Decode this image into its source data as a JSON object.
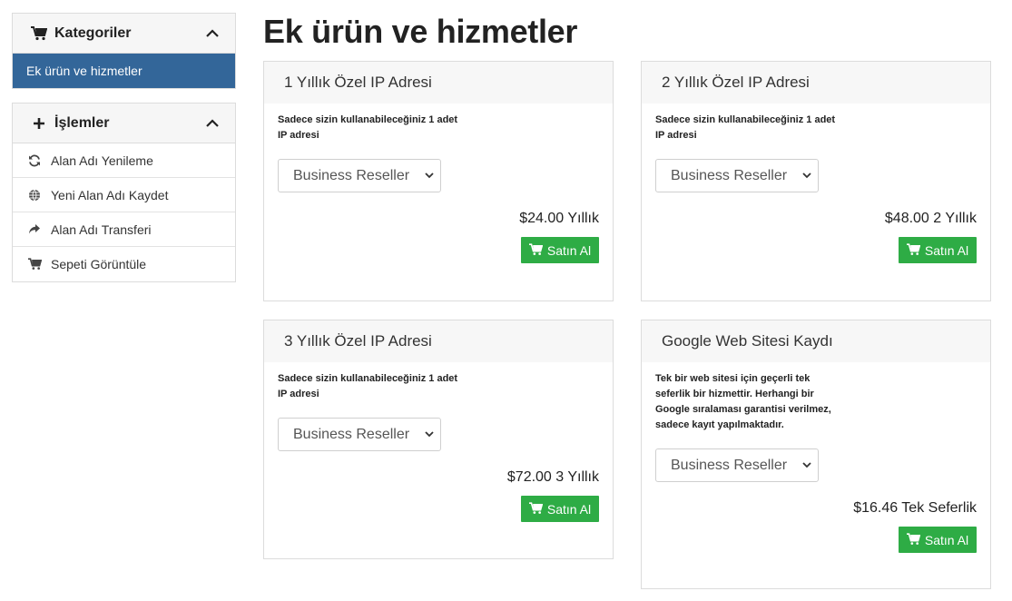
{
  "sidebar": {
    "categories": {
      "title": "Kategoriler",
      "icon": "cart-icon",
      "items": [
        {
          "label": "Ek ürün ve hizmetler",
          "active": true
        }
      ]
    },
    "actions": {
      "title": "İşlemler",
      "icon": "plus-icon",
      "items": [
        {
          "label": "Alan Adı Yenileme",
          "icon": "refresh-icon"
        },
        {
          "label": "Yeni Alan Adı Kaydet",
          "icon": "globe-icon"
        },
        {
          "label": "Alan Adı Transferi",
          "icon": "share-arrow-icon"
        },
        {
          "label": "Sepeti Görüntüle",
          "icon": "cart-icon"
        }
      ]
    }
  },
  "main": {
    "title": "Ek ürün ve hizmetler",
    "products": [
      {
        "name": "1 Yıllık Özel IP Adresi",
        "description": "Sadece sizin kullanabileceğiniz 1 adet IP adresi",
        "select_value": "Business Reseller",
        "price": "$24.00 Yıllık",
        "buy_label": "Satın Al"
      },
      {
        "name": "2 Yıllık Özel IP Adresi",
        "description": "Sadece sizin kullanabileceğiniz 1 adet IP adresi",
        "select_value": "Business Reseller",
        "price": "$48.00 2 Yıllık",
        "buy_label": "Satın Al"
      },
      {
        "name": "3 Yıllık Özel IP Adresi",
        "description": "Sadece sizin kullanabileceğiniz 1 adet IP adresi",
        "select_value": "Business Reseller",
        "price": "$72.00 3 Yıllık",
        "buy_label": "Satın Al"
      },
      {
        "name": "Google Web Sitesi Kaydı",
        "description": "Tek bir web sitesi için geçerli tek seferlik bir hizmettir. Herhangi bir Google sıralaması garantisi verilmez, sadece kayıt yapılmaktadır.",
        "select_value": "Business Reseller",
        "price": "$16.46 Tek Seferlik",
        "buy_label": "Satın Al"
      }
    ]
  },
  "colors": {
    "active_item_bg": "#336699",
    "buy_button_bg": "#2eac45",
    "header_bg": "#f6f6f6",
    "border": "#dcdcdc"
  }
}
